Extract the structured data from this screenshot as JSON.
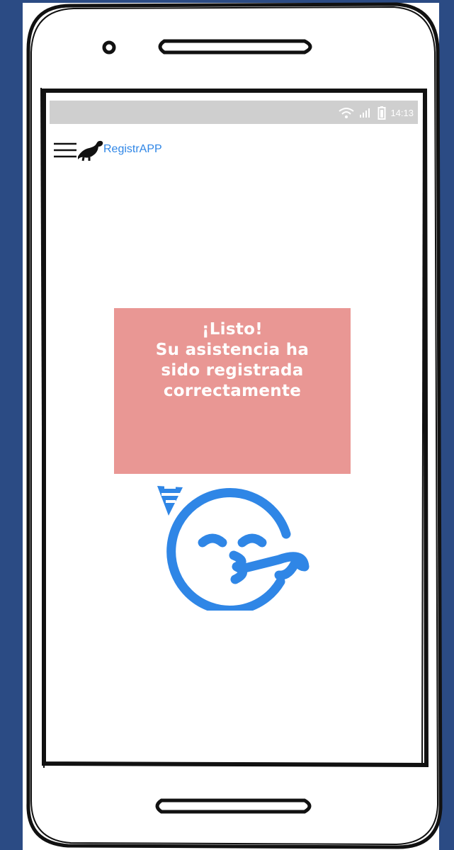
{
  "status_bar": {
    "time": "14:13",
    "icons": [
      "wifi-icon",
      "signal-icon",
      "battery-icon"
    ]
  },
  "app_bar": {
    "menu_icon": "menu-icon",
    "logo_icon": "dinosaur-logo-icon",
    "brand": "RegistrAPP"
  },
  "message": {
    "lines": [
      "¡Listo!",
      "Su asistencia ha",
      "sido registrada",
      "correctamente"
    ]
  },
  "illustration": {
    "icon": "party-face-icon"
  },
  "colors": {
    "background": "#2b4b84",
    "message_box": "#e99794",
    "accent_blue": "#2f86e6",
    "status_bar": "#cfcfcf"
  }
}
